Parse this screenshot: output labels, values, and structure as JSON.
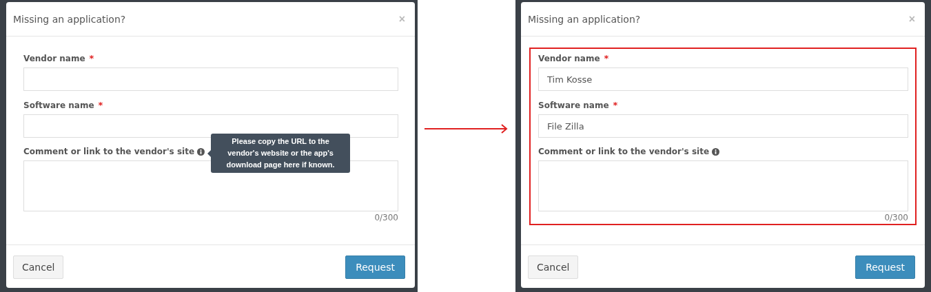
{
  "dialogs": [
    {
      "title": "Missing an application?",
      "close": "×",
      "highlighted": false,
      "fields": [
        {
          "kind": "text",
          "label": "Vendor name",
          "required_mark": "*"
        },
        {
          "kind": "text",
          "label": "Software name",
          "required_mark": "*"
        },
        {
          "kind": "textarea",
          "label": "Comment or link to the vendor's site",
          "counter": "0/300",
          "tooltip": "Please copy the URL to the vendor's website or the app's download page here if known."
        }
      ],
      "buttons": [
        {
          "kind": "default",
          "label": "Cancel"
        },
        {
          "kind": "primary",
          "label": "Request"
        }
      ]
    },
    {
      "title": "Missing an application?",
      "close": "×",
      "highlighted": true,
      "fields": [
        {
          "kind": "text",
          "label": "Vendor name",
          "required_mark": "*",
          "value": "Tim Kosse"
        },
        {
          "kind": "text",
          "label": "Software name",
          "required_mark": "*",
          "value": "File Zilla"
        },
        {
          "kind": "textarea",
          "label": "Comment or link to the vendor's site",
          "counter": "0/300"
        }
      ],
      "buttons": [
        {
          "kind": "default",
          "label": "Cancel"
        },
        {
          "kind": "primary",
          "label": "Request"
        }
      ]
    }
  ]
}
